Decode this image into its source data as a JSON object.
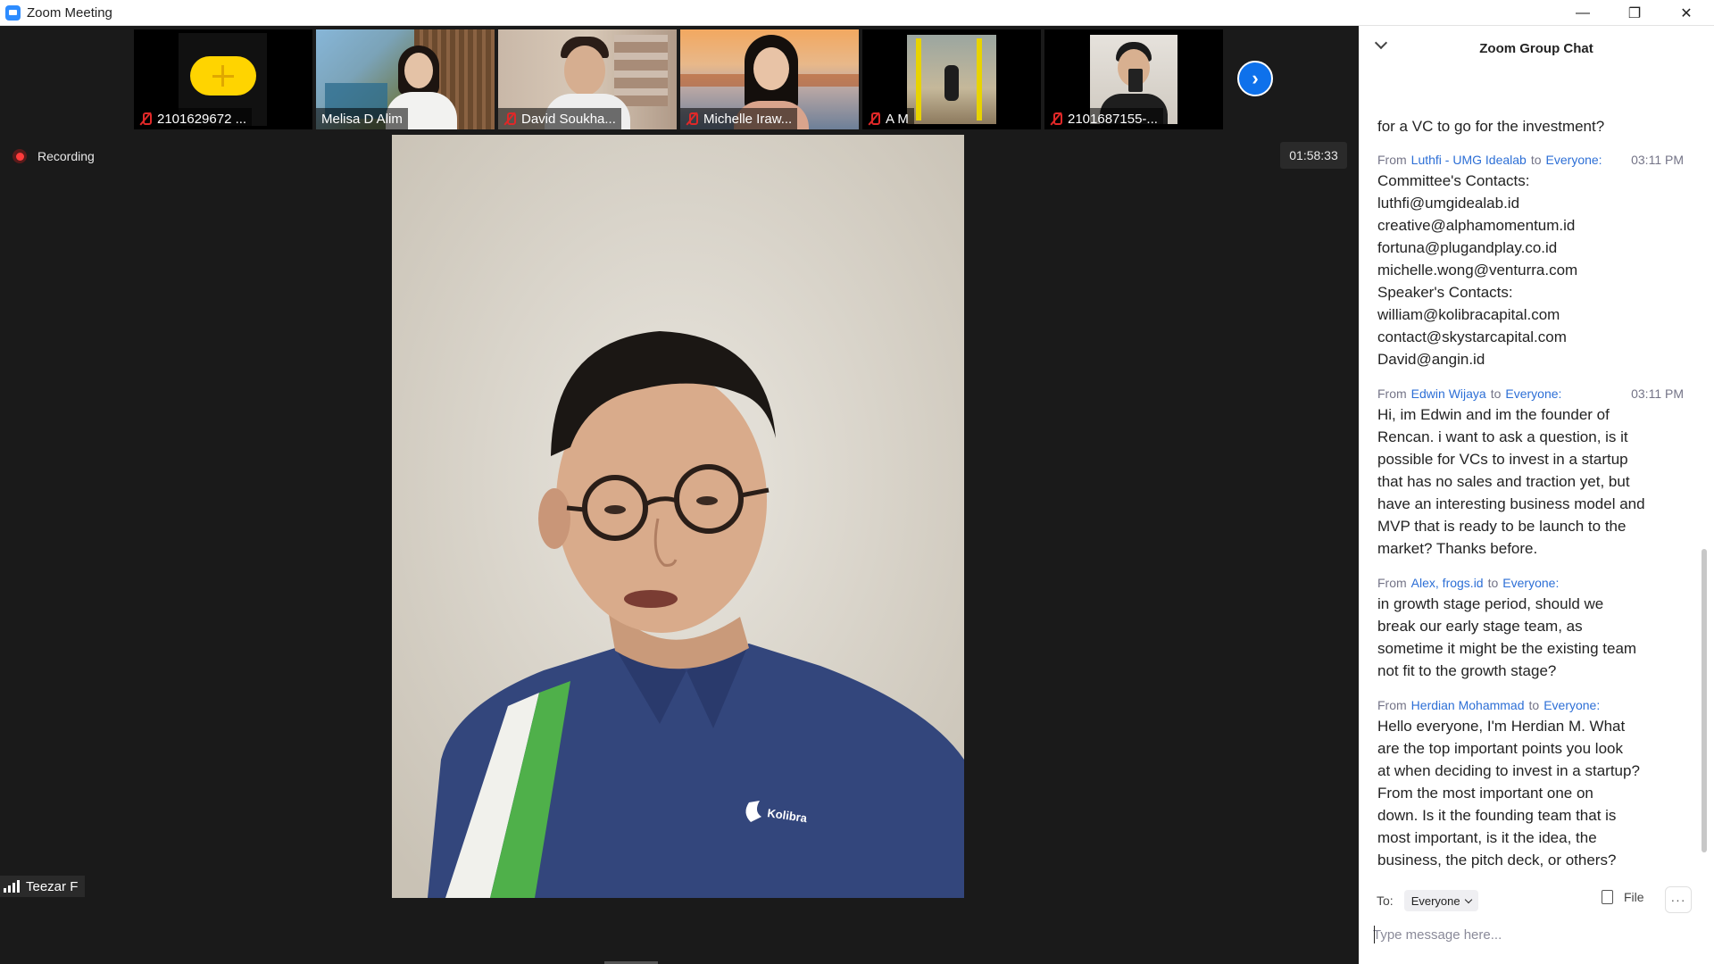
{
  "window": {
    "title": "Zoom Meeting",
    "controls": {
      "minimize": "—",
      "maximize": "❐",
      "close": "✕"
    }
  },
  "gallery": {
    "participants": [
      {
        "name": "2101629672 ...",
        "muted": true,
        "video": "placeholder"
      },
      {
        "name": "Melisa D Alim",
        "muted": false,
        "video": "camera"
      },
      {
        "name": "David Soukha...",
        "muted": true,
        "video": "camera"
      },
      {
        "name": "Michelle Iraw...",
        "muted": true,
        "video": "camera"
      },
      {
        "name": "A M",
        "muted": true,
        "video": "camera"
      },
      {
        "name": "2101687155-...",
        "muted": true,
        "video": "camera"
      }
    ],
    "next_icon": "chevron-right-icon"
  },
  "recording": {
    "label": "Recording"
  },
  "timer": {
    "value": "01:58:33"
  },
  "active_speaker": {
    "name": "Teezar F",
    "shirt_logo": "Kolibra"
  },
  "chat": {
    "title": "Zoom Group Chat",
    "partial_top": "for a VC to go for the investment?",
    "messages": [
      {
        "from": "Luthfi - UMG Idealab",
        "to": "Everyone:",
        "time": "03:11 PM",
        "text": "Committee's Contacts:\nluthfi@umgidealab.id\ncreative@alphamomentum.id\nfortuna@plugandplay.co.id\nmichelle.wong@venturra.com\nSpeaker's Contacts:\nwilliam@kolibracapital.com\ncontact@skystarcapital.com\nDavid@angin.id"
      },
      {
        "from": "Edwin Wijaya",
        "to": "Everyone:",
        "time": "03:11 PM",
        "text": "Hi, im Edwin and im the founder of\nRencan. i want to ask a question, is it\npossible for VCs to invest in a startup\nthat has no sales and traction yet, but\nhave an interesting business model and\nMVP that is ready to be launch to the\nmarket? Thanks before."
      },
      {
        "from": "Alex, frogs.id",
        "to": "Everyone:",
        "time": "",
        "text": "in growth stage period, should we\nbreak our early stage team, as\nsometime it might be the existing team\nnot fit to the growth stage?"
      },
      {
        "from": "Herdian Mohammad",
        "to": "Everyone:",
        "time": "",
        "text": "Hello everyone, I'm Herdian M. What\nare the top important points you look\nat when deciding to invest in a startup?\nFrom the most important one on\ndown. Is it the founding team that is\nmost important, is it the idea, the\nbusiness, the pitch deck, or others?"
      }
    ],
    "composer": {
      "to_label": "To:",
      "to_value": "Everyone",
      "file_label": "File",
      "more_label": "···",
      "placeholder": "Type message here..."
    }
  },
  "colors": {
    "stage_bg": "#1a1a1a",
    "accent": "#0e71eb",
    "link": "#2d6fd6",
    "mute_red": "#e02828"
  }
}
